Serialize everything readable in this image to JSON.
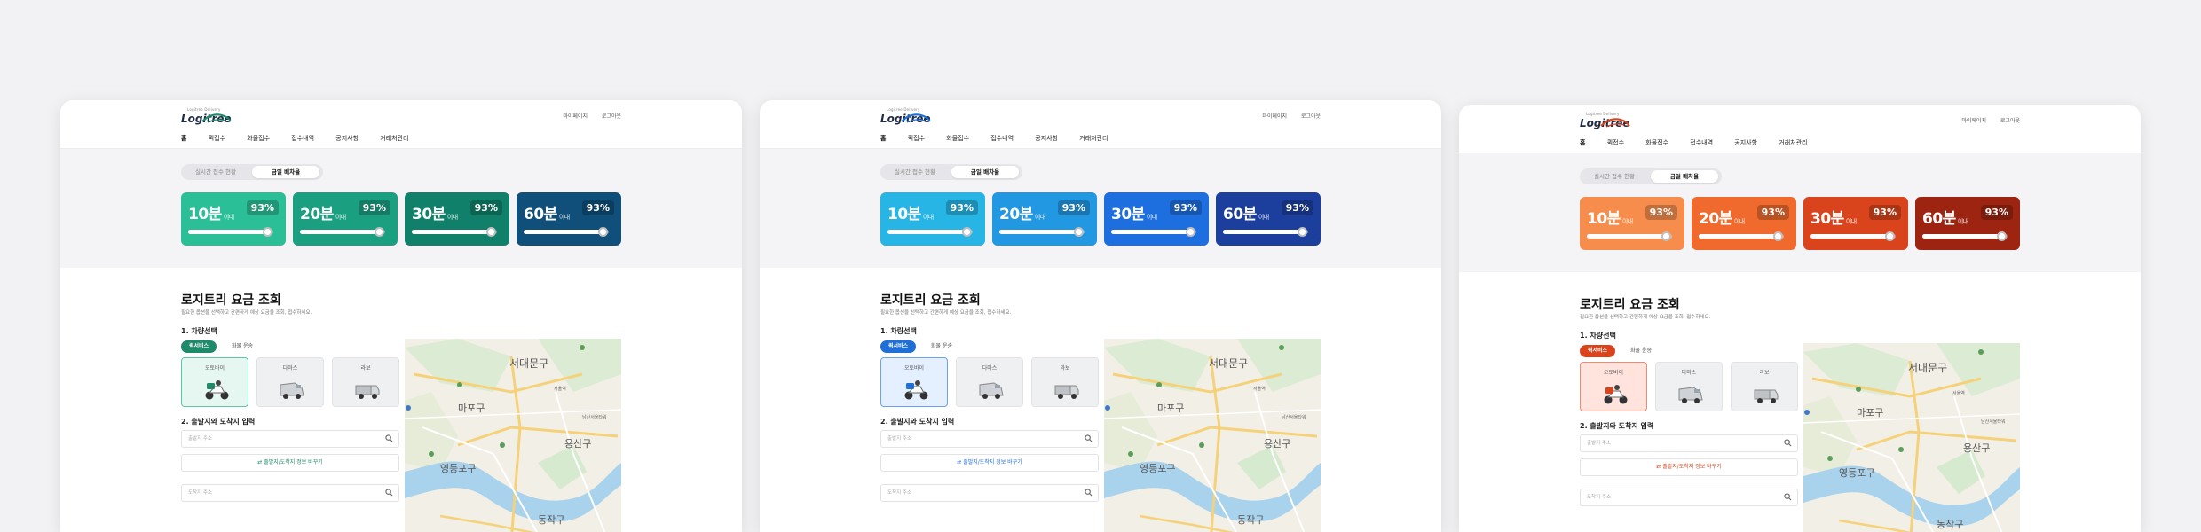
{
  "logo": {
    "sub": "Logitree Delivery",
    "text": "Logitree"
  },
  "util": {
    "mypage": "마이페이지",
    "logout": "로그아웃"
  },
  "nav": [
    "홈",
    "퀵접수",
    "화물접수",
    "접수내역",
    "공지사항",
    "거래처관리"
  ],
  "segment": {
    "realtime": "실시간 접수 현황",
    "rate": "금일 배차율"
  },
  "cards": [
    {
      "min": "10분",
      "unit": "이내",
      "pct": "93%",
      "fill": 0.93
    },
    {
      "min": "20분",
      "unit": "이내",
      "pct": "93%",
      "fill": 0.93
    },
    {
      "min": "30분",
      "unit": "이내",
      "pct": "93%",
      "fill": 0.93
    },
    {
      "min": "60분",
      "unit": "이내",
      "pct": "93%",
      "fill": 0.93
    }
  ],
  "fare": {
    "title": "로지트리 요금 조회",
    "desc": "필요한 옵션을 선택하고 간편하게 예상 요금을 조회, 접수하세요.",
    "step1": "1. 차량선택",
    "pill_on": "퀵서비스",
    "pill_off": "화물 운송",
    "vehicles": [
      "오토바이",
      "다마스",
      "라보"
    ],
    "step2": "2. 출발지와 도착지 입력",
    "origin_placeholder": "출발지 주소",
    "swap_label": "출발지/도착지 정보 바꾸기",
    "dest_placeholder": "도착지 주소"
  },
  "map": {
    "labels": [
      "서대문구",
      "마포구",
      "용산구",
      "영등포구",
      "동작구",
      "남산서울타워",
      "서울역"
    ]
  },
  "themes": [
    {
      "name": "green",
      "accent": "#1f8a6a",
      "cards": [
        "#2bbf98",
        "#1a9f80",
        "#10806a",
        "#0f4f7a"
      ],
      "sel_bg": "#e6f7f1",
      "sel_border": "#5cc7a6"
    },
    {
      "name": "blue",
      "accent": "#1f6fd6",
      "cards": [
        "#27b5e6",
        "#2297e2",
        "#1d6fe0",
        "#1c3f9e"
      ],
      "sel_bg": "#e4efff",
      "sel_border": "#6aa2ef"
    },
    {
      "name": "orange",
      "accent": "#d9441c",
      "cards": [
        "#f78d4c",
        "#f06a2d",
        "#d9441c",
        "#9c2410"
      ],
      "sel_bg": "#ffe3dc",
      "sel_border": "#f08a70"
    }
  ]
}
